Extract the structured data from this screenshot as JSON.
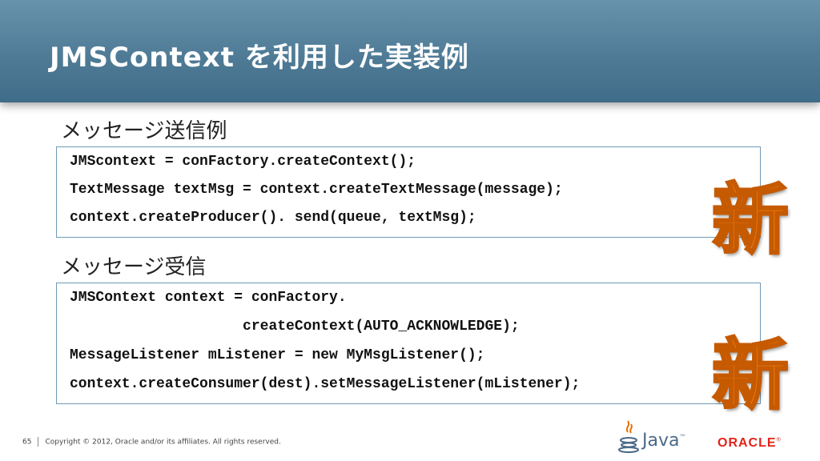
{
  "header": {
    "title": "JMSContext を利用した実装例"
  },
  "send_section": {
    "label": "メッセージ送信例",
    "code": [
      "JMScontext = conFactory.createContext();",
      "TextMessage textMsg = context.createTextMessage(message);",
      "context.createProducer(). send(queue, textMsg);"
    ]
  },
  "receive_section": {
    "label": "メッセージ受信",
    "code": [
      "JMSContext context = conFactory.",
      "                    createContext(AUTO_ACKNOWLEDGE);",
      "MessageListener mListener = new MyMsgListener();",
      "context.createConsumer(dest).setMessageListener(mListener);"
    ]
  },
  "badges": {
    "new_1": "新",
    "new_2": "新"
  },
  "footer": {
    "page_number": "65",
    "copyright": "Copyright © 2012, Oracle and/or its affiliates. All rights reserved."
  },
  "logos": {
    "java": "Java",
    "java_tm": "™",
    "oracle": "ORACLE",
    "oracle_reg": "®"
  },
  "colors": {
    "title_bar": "#4f7b96",
    "box_border": "#6f9ab6",
    "new_mark": "#f07a16",
    "oracle_red": "#e2231a",
    "java_blue": "#4b6a87"
  }
}
